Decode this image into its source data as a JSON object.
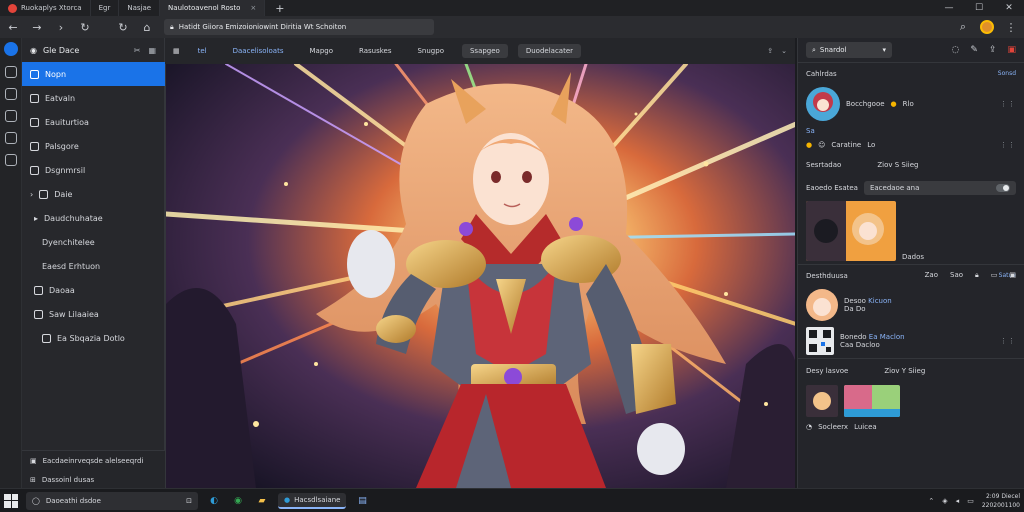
{
  "browser": {
    "tabs": [
      {
        "label": "Ruokaplys Xtorca",
        "active": false
      },
      {
        "label": "Egr",
        "active": false
      },
      {
        "label": "Nasjae",
        "active": false
      },
      {
        "label": "Naulotoavenol Rosto",
        "active": true
      }
    ],
    "address": "Hatidt Giiora Emizoioniowint Diritia Wt Schoiton",
    "new_tab_glyph": "+",
    "window_controls": [
      "—",
      "☐",
      "✕"
    ]
  },
  "sidebar": {
    "header": "Gle Dace",
    "items": [
      {
        "label": "Nopn",
        "active": true
      },
      {
        "label": "Eatvaln",
        "active": false
      },
      {
        "label": "Eauiturtioa",
        "active": false
      },
      {
        "label": "Palsgore",
        "active": false
      },
      {
        "label": "Dsgnmrsil",
        "active": false
      },
      {
        "label": "Daie",
        "active": false
      },
      {
        "label": "Daudchuhatae",
        "active": false
      },
      {
        "label": "Dyenchitelee",
        "active": false
      },
      {
        "label": "Eaesd Erhtuon",
        "active": false
      },
      {
        "label": "Daoaa",
        "active": false
      },
      {
        "label": "Saw Lilaaiea",
        "active": false
      },
      {
        "label": "Ea Sbqazia Dotlo",
        "active": false
      }
    ],
    "footer": [
      "Eacdaeinrveqsde alelseeqrdi",
      "Dassoinl dusas"
    ]
  },
  "viewer": {
    "toolbar": [
      "tel",
      "Daacelisoloats",
      "Mapgo",
      "Rasuskes",
      "Snugpo",
      "Ssapgeo",
      "Duodelacater"
    ]
  },
  "right_panel": {
    "search": "Snardol",
    "section_1": {
      "title": "Cahlrdas",
      "link": "Sonsd"
    },
    "user_1": {
      "name": "Bocchgooe",
      "handle": "Rlo",
      "badge": "Sa"
    },
    "user_1_actions": {
      "label": "Caratine",
      "count": "Lo"
    },
    "info_row": {
      "left": "Sesrtadao",
      "right": "Ziov S Siieg"
    },
    "setting_row": {
      "label": "Eaoedo Esatea",
      "field": "Eacedaoe ana"
    },
    "gallery_caption": "Dados",
    "section_2": {
      "title": "Desthduusa",
      "link": "Satue"
    },
    "icon_row": [
      "Zao",
      "Sao"
    ],
    "user_2": {
      "name": "Desoo",
      "handle": "Kicuon",
      "sub": "Da Do"
    },
    "user_3": {
      "name": "Bonedo",
      "handle": "Ea Maclon",
      "sub": "Caa Dacloo"
    },
    "section_3": {
      "left": "Desy lasvoe",
      "right": "Ziov Y Siieg"
    },
    "user_4": {
      "name": "Socleerx",
      "sub": "Luicea"
    },
    "more_glyph": "⋮⋮"
  },
  "taskbar": {
    "search": "Daoeathi dsdoe",
    "open_app": "Hacsdlsaiane",
    "clock_time": "2:09 Diecel",
    "clock_date": "2202001100"
  },
  "colors": {
    "accent": "#1a73e8",
    "link": "#8ab4f8",
    "panel": "#24252a"
  }
}
